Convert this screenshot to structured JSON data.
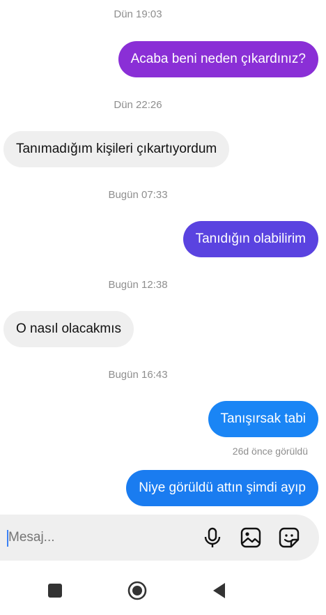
{
  "messages": [
    {
      "timestamp": "Dün 19:03",
      "text": "Acaba beni neden çıkardınız?",
      "direction": "outgoing",
      "color": "#8a2fd6"
    },
    {
      "timestamp": "Dün 22:26",
      "text": "Tanımadığım kişileri çıkartıyordum",
      "direction": "incoming"
    },
    {
      "timestamp": "Bugün 07:33",
      "text": "Tanıdığın olabilirim",
      "direction": "outgoing",
      "color": "#5a43e0"
    },
    {
      "timestamp": "Bugün 12:38",
      "text": "O nasıl olacakmıs",
      "direction": "incoming"
    },
    {
      "timestamp": "Bugün 16:43",
      "text": "Tanışırsak tabi",
      "direction": "outgoing",
      "color": "#1a85f5"
    },
    {
      "text": "Niye görüldü attın şimdi ayıp",
      "direction": "outgoing",
      "color": "#1a7cf0"
    }
  ],
  "seen_status": "26d önce görüldü",
  "composer": {
    "placeholder": "Mesaj...",
    "icons": [
      "microphone-icon",
      "image-icon",
      "sticker-icon"
    ]
  },
  "navigation": {
    "buttons": [
      "recents-button",
      "home-button",
      "back-button"
    ]
  }
}
